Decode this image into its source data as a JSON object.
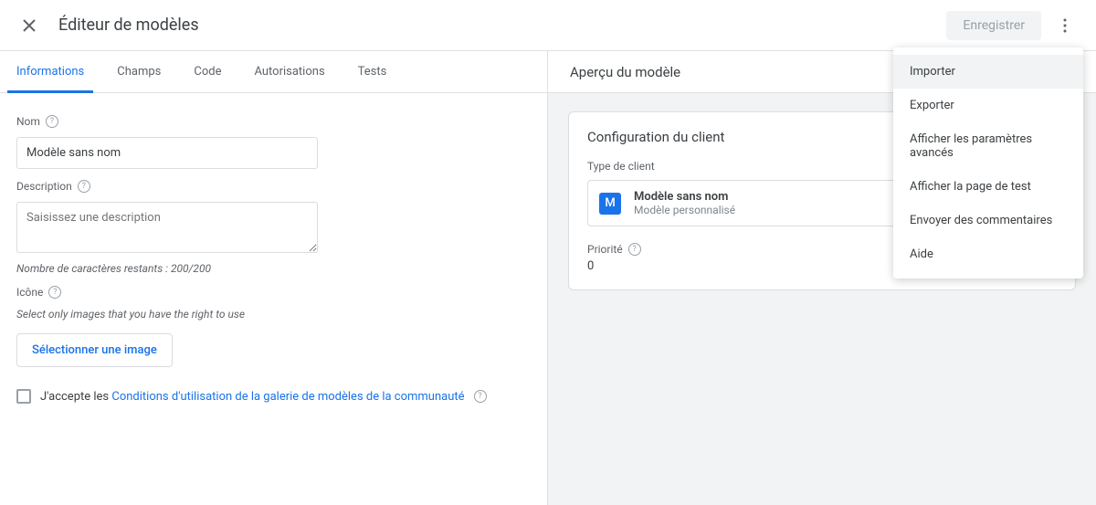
{
  "header": {
    "title": "Éditeur de modèles",
    "save_label": "Enregistrer"
  },
  "dropdown": {
    "items": [
      "Importer",
      "Exporter",
      "Afficher les paramètres avancés",
      "Afficher la page de test",
      "Envoyer des commentaires",
      "Aide"
    ]
  },
  "tabs": [
    "Informations",
    "Champs",
    "Code",
    "Autorisations",
    "Tests"
  ],
  "form": {
    "name_label": "Nom",
    "name_value": "Modèle sans nom",
    "desc_label": "Description",
    "desc_placeholder": "Saisissez une description",
    "desc_hint": "Nombre de caractères restants : 200/200",
    "icon_label": "Icône",
    "icon_hint": "Select only images that you have the right to use",
    "select_image_label": "Sélectionner une image",
    "checkbox_prefix": "J'accepte les ",
    "checkbox_link": "Conditions d'utilisation de la galerie de modèles de la communauté"
  },
  "preview": {
    "title": "Aperçu du modèle",
    "card_title": "Configuration du client",
    "type_label": "Type de client",
    "client_icon_letter": "M",
    "client_name": "Modèle sans nom",
    "client_sub": "Modèle personnalisé",
    "priority_label": "Priorité",
    "priority_value": "0"
  }
}
